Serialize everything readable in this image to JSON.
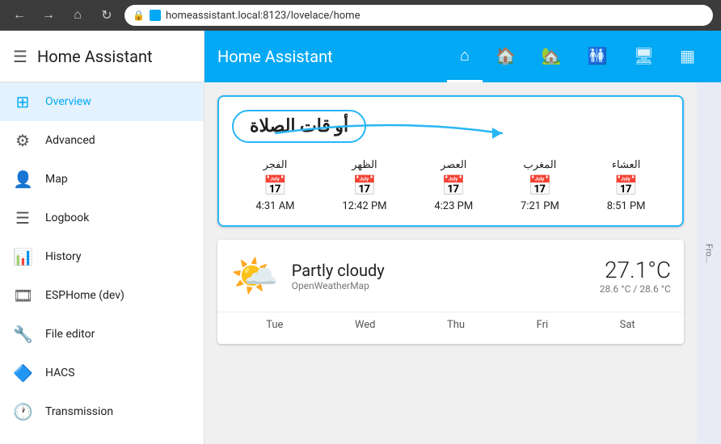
{
  "browser": {
    "back_title": "Back",
    "forward_title": "Forward",
    "home_title": "Home",
    "reload_title": "Reload",
    "address": "homeassistant.local:8123/lovelace/home"
  },
  "sidebar": {
    "title": "Home Assistant",
    "hamburger_label": "≡",
    "items": [
      {
        "id": "overview",
        "icon": "⊞",
        "label": "Overview",
        "active": true
      },
      {
        "id": "advanced",
        "icon": "⚙",
        "label": "Advanced",
        "active": false
      },
      {
        "id": "map",
        "icon": "👤",
        "label": "Map",
        "active": false
      },
      {
        "id": "logbook",
        "icon": "☰",
        "label": "Logbook",
        "active": false
      },
      {
        "id": "history",
        "icon": "📊",
        "label": "History",
        "active": false
      },
      {
        "id": "esphome",
        "icon": "🎞",
        "label": "ESPHome (dev)",
        "active": false
      },
      {
        "id": "file-editor",
        "icon": "🔧",
        "label": "File editor",
        "active": false
      },
      {
        "id": "hacs",
        "icon": "🔷",
        "label": "HACS",
        "active": false
      },
      {
        "id": "transmission",
        "icon": "🕐",
        "label": "Transmission",
        "active": false
      }
    ]
  },
  "topbar": {
    "title": "Home Assistant",
    "tabs": [
      {
        "id": "home",
        "icon": "⌂",
        "active": true
      },
      {
        "id": "floor",
        "icon": "🏠",
        "active": false
      },
      {
        "id": "house",
        "icon": "🏡",
        "active": false
      },
      {
        "id": "bathtub",
        "icon": "🛁",
        "active": false
      },
      {
        "id": "monitor",
        "icon": "🖥",
        "active": false
      },
      {
        "id": "network",
        "icon": "⊞",
        "active": false
      }
    ]
  },
  "prayer_card": {
    "title": "أو قات الصلاة",
    "times": [
      {
        "name": "العشاء",
        "value": "8:51 PM"
      },
      {
        "name": "المغرب",
        "value": "7:21 PM"
      },
      {
        "name": "العصر",
        "value": "4:23 PM"
      },
      {
        "name": "الظهر",
        "value": "12:42 PM"
      },
      {
        "name": "الفجر",
        "value": "4:31 AM"
      }
    ]
  },
  "weather_card": {
    "condition": "Partly cloudy",
    "source": "OpenWeatherMap",
    "temperature": "27.1°C",
    "range": "28.6 °C / 28.6 °C",
    "days": [
      "Tue",
      "Wed",
      "Thu",
      "Fri",
      "Sat"
    ]
  },
  "side_panel": {
    "label": "Fro..."
  }
}
